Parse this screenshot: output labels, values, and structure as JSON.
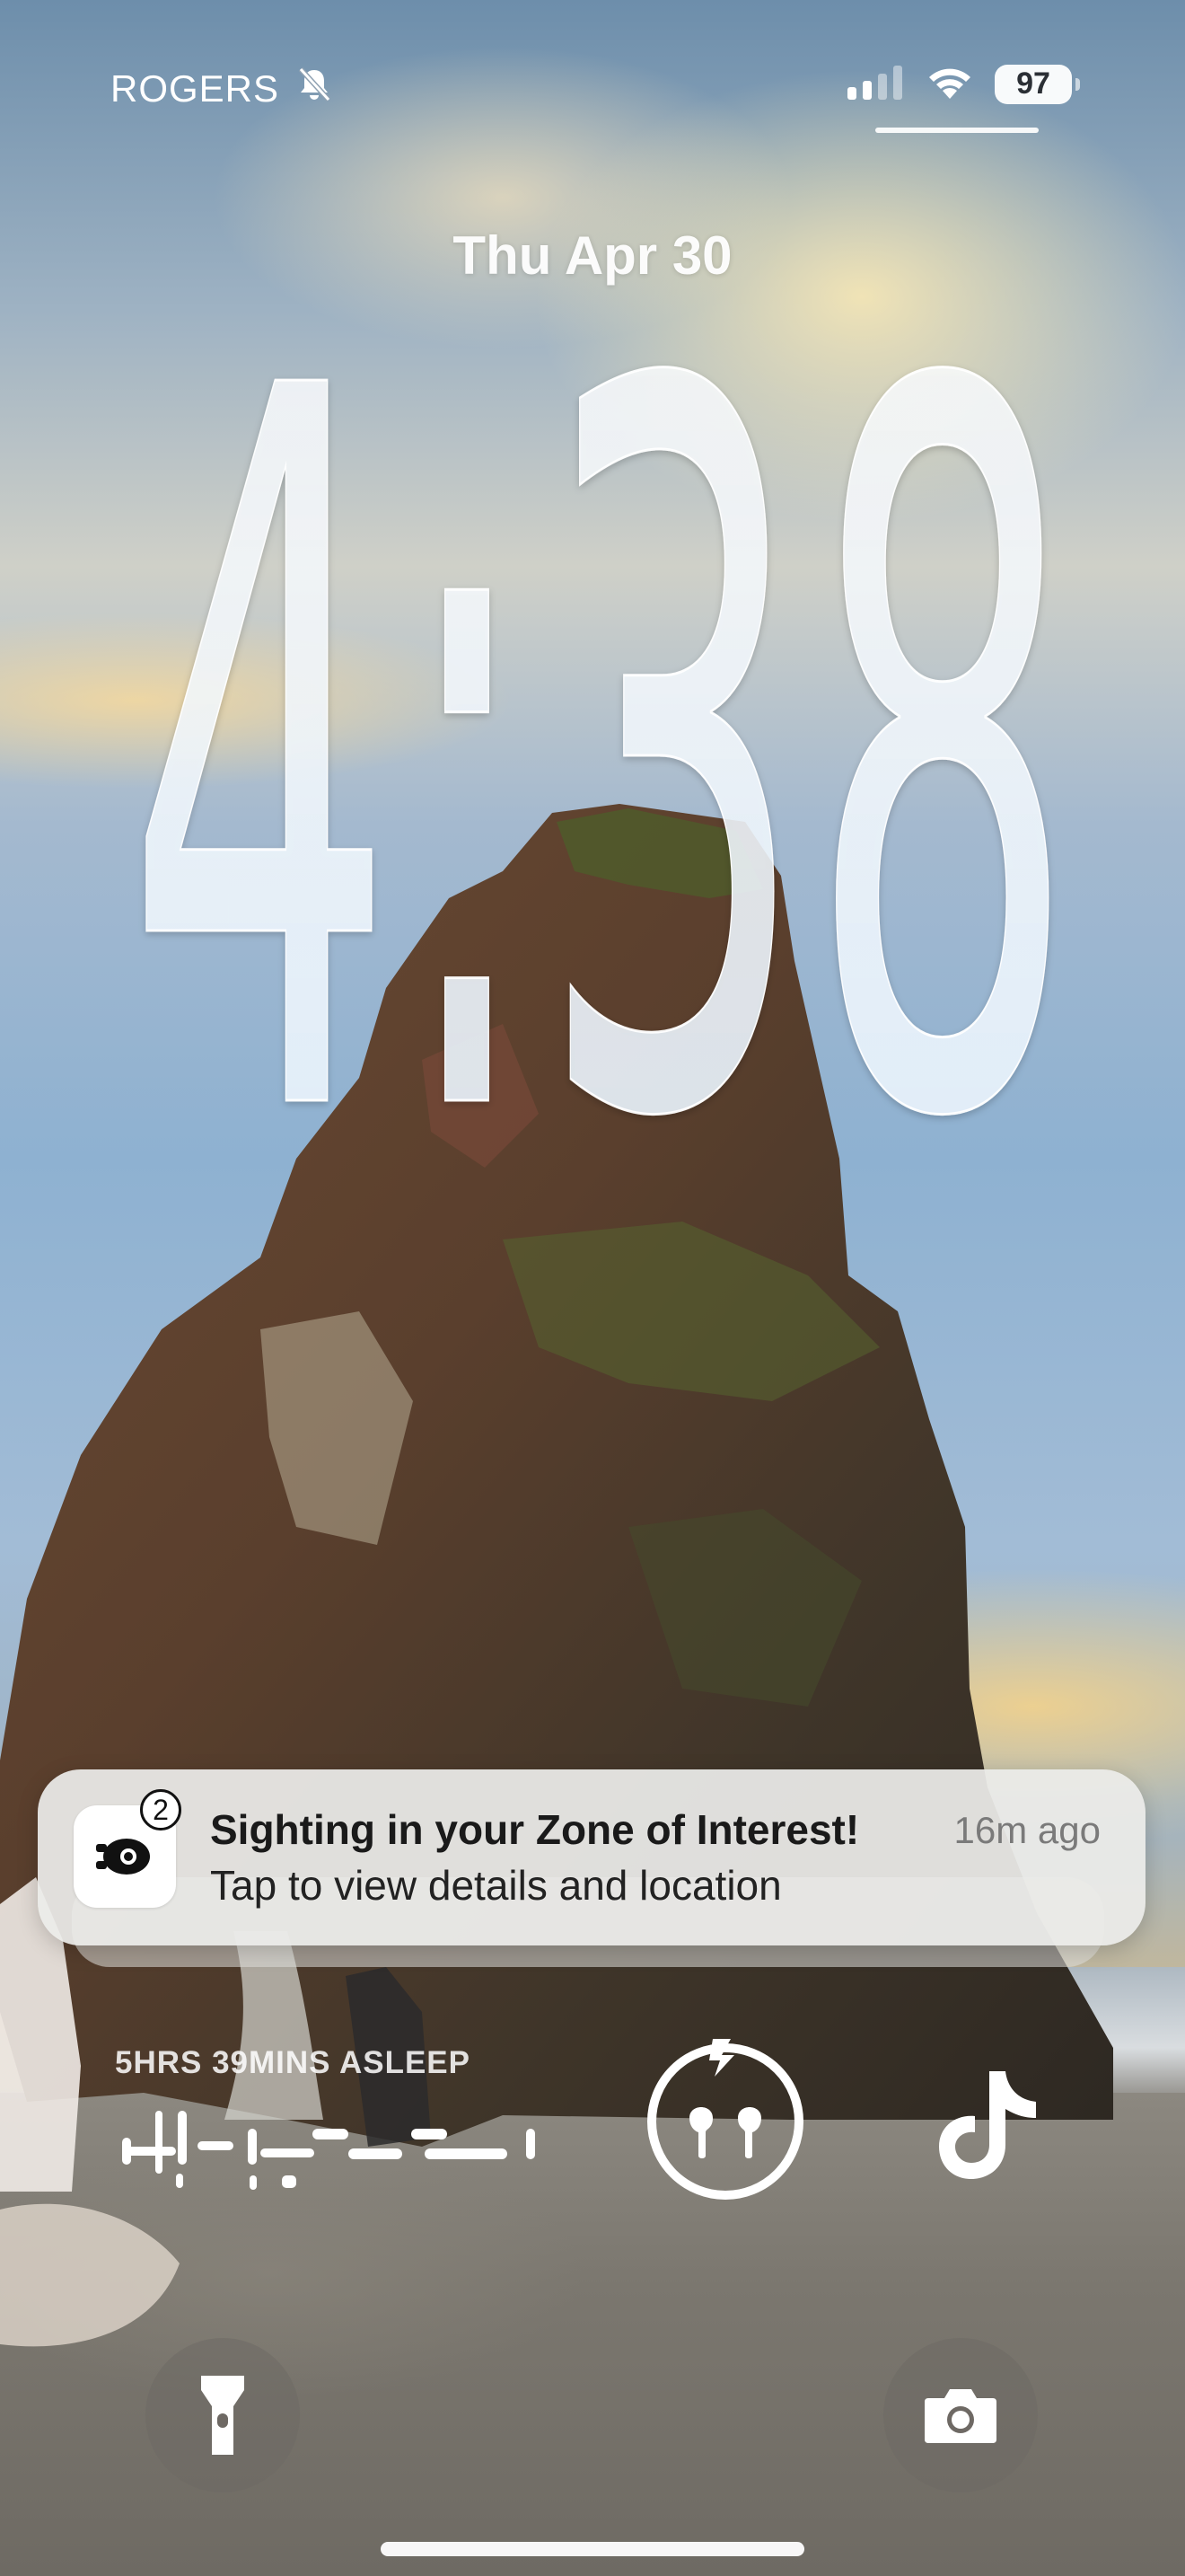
{
  "status_bar": {
    "carrier": "ROGERS",
    "silent_icon": "bell-slash-icon",
    "signal_icon": "cellular-signal-icon",
    "wifi_icon": "wifi-icon",
    "battery": "97"
  },
  "lock_screen": {
    "date": "Thu Apr 30",
    "time": "4:38"
  },
  "notification": {
    "app_icon": "eye-camera-app-icon",
    "badge_count": "2",
    "title": "Sighting in your Zone of Interest!",
    "time": "16m ago",
    "body": "Tap to view details and location"
  },
  "widgets": {
    "sleep_label": "5HRS 39MINS ASLEEP",
    "airpods_icon": "airpods-charging-icon",
    "tiktok_icon": "tiktok-icon"
  },
  "quick_actions": {
    "flashlight_icon": "flashlight-icon",
    "camera_icon": "camera-icon"
  },
  "colors": {
    "notification_bg": "#ecece9",
    "text_white": "#ffffff"
  }
}
